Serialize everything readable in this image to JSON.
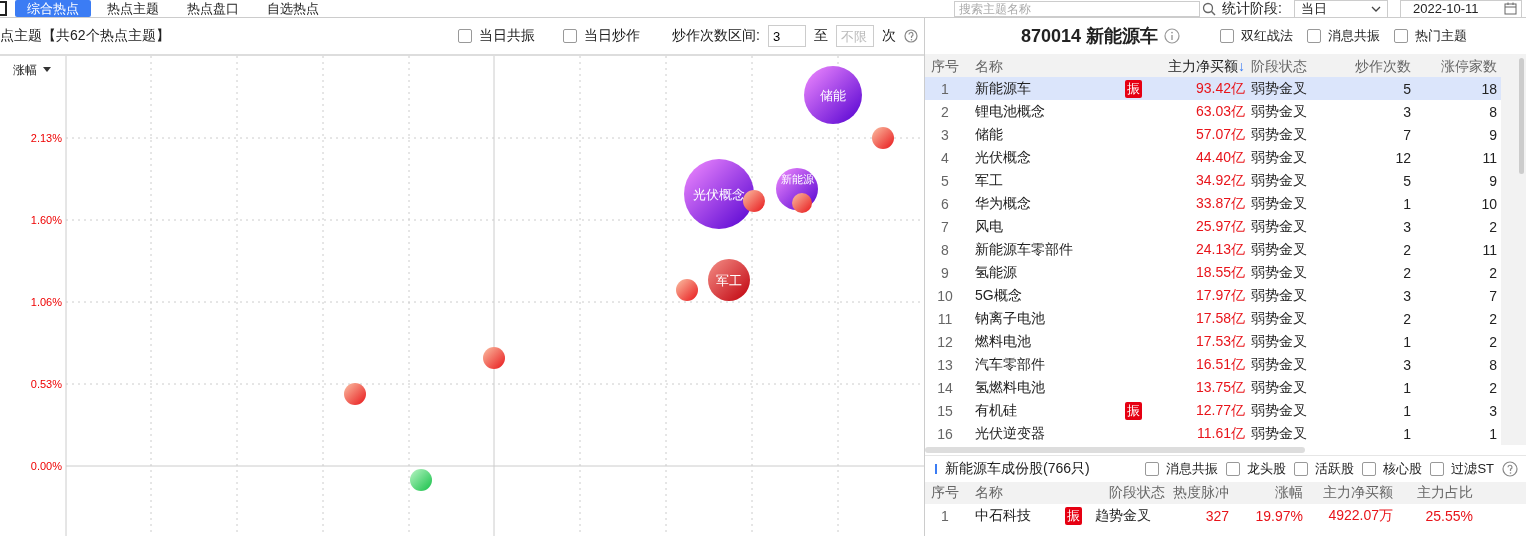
{
  "top_bar": {
    "tabs": [
      {
        "label": "综合热点",
        "selected": true
      },
      {
        "label": "热点主题",
        "selected": false
      },
      {
        "label": "热点盘口",
        "selected": false
      },
      {
        "label": "自选热点",
        "selected": false
      }
    ],
    "search": {
      "placeholder": "搜索主题名称"
    },
    "period": {
      "label": "统计阶段:",
      "value": "当日"
    },
    "date": {
      "value": "2022-10-11"
    }
  },
  "left_panel": {
    "title": "点主题【共62个热点主题】",
    "filters": [
      {
        "label": "当日共振",
        "checked": false
      },
      {
        "label": "当日炒作",
        "checked": false
      }
    ],
    "range": {
      "label": "炒作次数区间:",
      "from": "3",
      "to_label": "至",
      "to_placeholder": "不限",
      "unit": "次"
    },
    "chart": {
      "y_label": "涨幅",
      "y_ticks": [
        "2.13%",
        "1.60%",
        "1.06%",
        "0.53%",
        "0.00%"
      ],
      "bubbles": [
        {
          "kind": "theme",
          "label": "储能"
        },
        {
          "kind": "small"
        },
        {
          "kind": "theme",
          "label": "光伏概念"
        },
        {
          "kind": "small"
        },
        {
          "kind": "theme",
          "label": "新能源"
        },
        {
          "kind": "small"
        },
        {
          "kind": "hot",
          "label": "军工"
        },
        {
          "kind": "small"
        },
        {
          "kind": "small"
        },
        {
          "kind": "small"
        },
        {
          "kind": "down"
        }
      ]
    }
  },
  "right_panel": {
    "title": "870014 新能源车",
    "options": [
      {
        "label": "双红战法",
        "checked": false
      },
      {
        "label": "消息共振",
        "checked": false
      },
      {
        "label": "热门主题",
        "checked": false
      }
    ],
    "table": {
      "columns": [
        "序号",
        "名称",
        "主力净买额",
        "阶段状态",
        "炒作次数",
        "涨停家数"
      ],
      "sort_mark": "↓",
      "rows": [
        {
          "no": "1",
          "name": "新能源车",
          "badge": "振",
          "amount": "93.42亿",
          "stage": "弱势金叉",
          "times": "5",
          "limit_up": "18",
          "selected": true
        },
        {
          "no": "2",
          "name": "锂电池概念",
          "amount": "63.03亿",
          "stage": "弱势金叉",
          "times": "3",
          "limit_up": "8",
          "selected": false
        },
        {
          "no": "3",
          "name": "储能",
          "amount": "57.07亿",
          "stage": "弱势金叉",
          "times": "7",
          "limit_up": "9",
          "selected": false
        },
        {
          "no": "4",
          "name": "光伏概念",
          "amount": "44.40亿",
          "stage": "弱势金叉",
          "times": "12",
          "limit_up": "11",
          "selected": false
        },
        {
          "no": "5",
          "name": "军工",
          "amount": "34.92亿",
          "stage": "弱势金叉",
          "times": "5",
          "limit_up": "9",
          "selected": false
        },
        {
          "no": "6",
          "name": "华为概念",
          "amount": "33.87亿",
          "stage": "弱势金叉",
          "times": "1",
          "limit_up": "10",
          "selected": false
        },
        {
          "no": "7",
          "name": "风电",
          "amount": "25.97亿",
          "stage": "弱势金叉",
          "times": "3",
          "limit_up": "2",
          "selected": false
        },
        {
          "no": "8",
          "name": "新能源车零部件",
          "amount": "24.13亿",
          "stage": "弱势金叉",
          "times": "2",
          "limit_up": "11",
          "selected": false
        },
        {
          "no": "9",
          "name": "氢能源",
          "amount": "18.55亿",
          "stage": "弱势金叉",
          "times": "2",
          "limit_up": "2",
          "selected": false
        },
        {
          "no": "10",
          "name": "5G概念",
          "amount": "17.97亿",
          "stage": "弱势金叉",
          "times": "3",
          "limit_up": "7",
          "selected": false
        },
        {
          "no": "11",
          "name": "钠离子电池",
          "amount": "17.58亿",
          "stage": "弱势金叉",
          "times": "2",
          "limit_up": "2",
          "selected": false
        },
        {
          "no": "12",
          "name": "燃料电池",
          "amount": "17.53亿",
          "stage": "弱势金叉",
          "times": "1",
          "limit_up": "2",
          "selected": false
        },
        {
          "no": "13",
          "name": "汽车零部件",
          "amount": "16.51亿",
          "stage": "弱势金叉",
          "times": "3",
          "limit_up": "8",
          "selected": false
        },
        {
          "no": "14",
          "name": "氢燃料电池",
          "amount": "13.75亿",
          "stage": "弱势金叉",
          "times": "1",
          "limit_up": "2",
          "selected": false
        },
        {
          "no": "15",
          "name": "有机硅",
          "badge": "振",
          "amount": "12.77亿",
          "stage": "弱势金叉",
          "times": "1",
          "limit_up": "3",
          "selected": false
        },
        {
          "no": "16",
          "name": "光伏逆变器",
          "amount": "11.61亿",
          "stage": "弱势金叉",
          "times": "1",
          "limit_up": "1",
          "selected": false
        }
      ]
    },
    "stocks": {
      "title": "新能源车成份股(766只)",
      "filters": [
        {
          "label": "消息共振",
          "checked": false
        },
        {
          "label": "龙头股",
          "checked": false
        },
        {
          "label": "活跃股",
          "checked": false
        },
        {
          "label": "核心股",
          "checked": false
        },
        {
          "label": "过滤ST",
          "checked": false
        }
      ],
      "columns": [
        "序号",
        "名称",
        "阶段状态",
        "热度脉冲",
        "涨幅",
        "主力净买额",
        "主力占比"
      ],
      "rows": [
        {
          "no": "1",
          "name": "中石科技",
          "badge": "振",
          "stage": "趋势金叉",
          "heat": "327",
          "change": "19.97%",
          "amount": "4922.07万",
          "ratio": "25.55%",
          "selected": false
        }
      ]
    }
  }
}
